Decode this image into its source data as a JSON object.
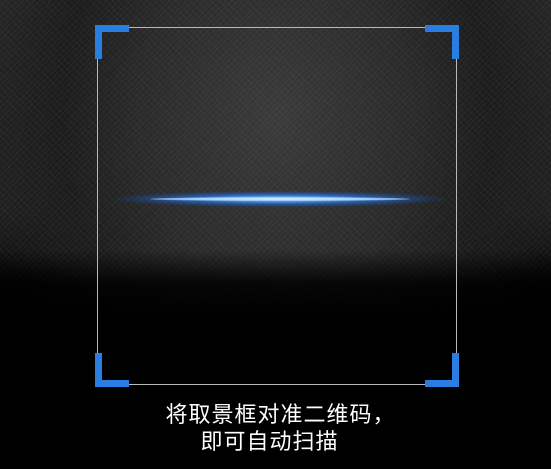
{
  "scanner": {
    "hint_line1": "将取景框对准二维码，",
    "hint_line2": "即可自动扫描",
    "accent_color": "#2a7de1",
    "scan_line_color": "#3a8cff"
  }
}
